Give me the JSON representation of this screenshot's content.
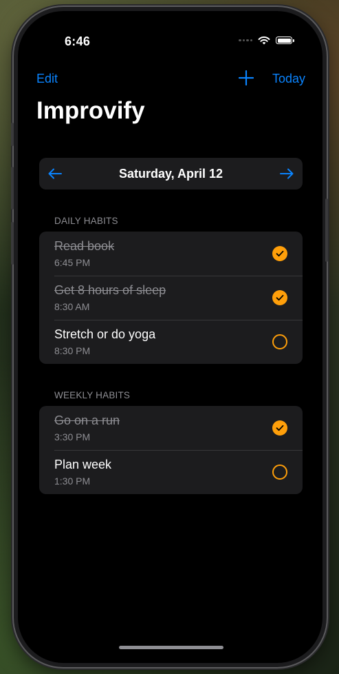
{
  "status": {
    "time": "6:46"
  },
  "nav": {
    "edit_label": "Edit",
    "add_icon": "plus-icon",
    "today_label": "Today"
  },
  "app": {
    "title": "Improvify"
  },
  "date_nav": {
    "date_label": "Saturday, April 12",
    "prev_icon": "arrow-left-icon",
    "next_icon": "arrow-right-icon"
  },
  "daily": {
    "header": "DAILY HABITS",
    "items": [
      {
        "title": "Read book",
        "time": "6:45 PM",
        "completed": true
      },
      {
        "title": "Get 8 hours of sleep",
        "time": "8:30 AM",
        "completed": true
      },
      {
        "title": "Stretch or do yoga",
        "time": "8:30 PM",
        "completed": false
      }
    ]
  },
  "weekly": {
    "header": "WEEKLY HABITS",
    "items": [
      {
        "title": "Go on a run",
        "time": "3:30 PM",
        "completed": true
      },
      {
        "title": "Plan week",
        "time": "1:30 PM",
        "completed": false
      }
    ]
  },
  "colors": {
    "accent": "#0a84ff",
    "check": "#ff9f0a",
    "background": "#000000",
    "card": "#1c1c1e"
  }
}
